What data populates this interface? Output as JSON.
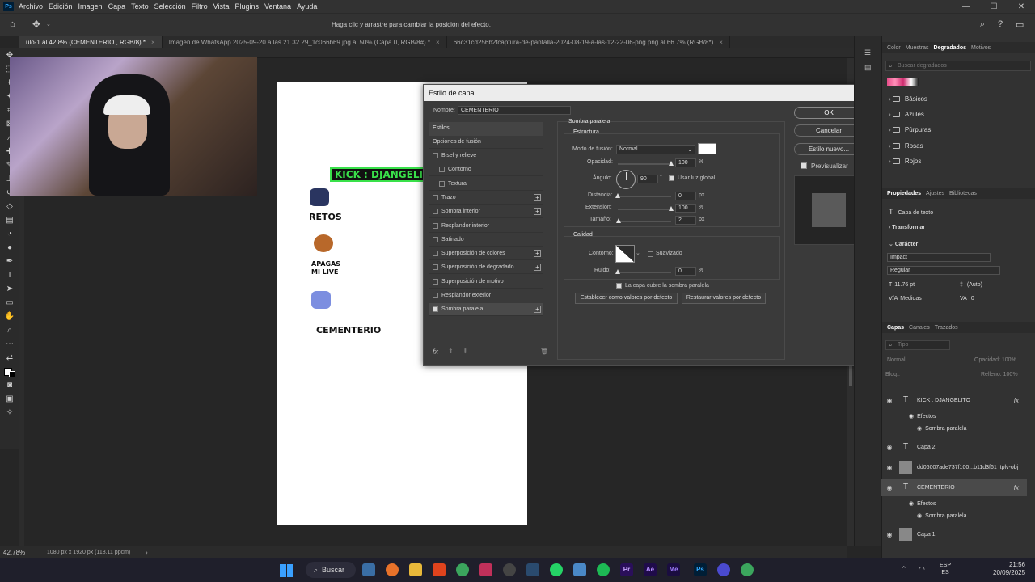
{
  "menu": [
    "Archivo",
    "Edición",
    "Imagen",
    "Capa",
    "Texto",
    "Selección",
    "Filtro",
    "Vista",
    "Plugins",
    "Ventana",
    "Ayuda"
  ],
  "options_hint": "Haga clic y arrastre para cambiar la posición del efecto.",
  "tabs": [
    {
      "label": "ulo-1 al 42.8% (CEMENTERIO , RGB/8) *",
      "active": true
    },
    {
      "label": "Imagen de WhatsApp 2025-09-20 a las 21.32.29_1c066b69.jpg al 50% (Capa 0, RGB/8#) *",
      "active": false
    },
    {
      "label": "66c31cd256b2fcaptura-de-pantalla-2024-08-19-a-las-12-22-06-png.png al 66.7% (RGB/8*)",
      "active": false
    }
  ],
  "status": {
    "zoom": "42.78%",
    "info": "1080 px x 1920 px (118.11 ppcm)"
  },
  "document": {
    "kick_text": "KICK : DJANGELITO",
    "items": [
      "RETOS",
      "APAGAS MI LIVE",
      "CEMENTERIO"
    ]
  },
  "dialog": {
    "title": "Estilo de capa",
    "name_label": "Nombre:",
    "name_value": "CEMENTERIO",
    "styles_header": "Estilos",
    "blend_options": "Opciones de fusión",
    "styles": [
      {
        "label": "Bisel y relieve",
        "checked": false,
        "plus": false
      },
      {
        "label": "Contorno",
        "checked": false,
        "plus": false
      },
      {
        "label": "Textura",
        "checked": false,
        "plus": false
      },
      {
        "label": "Trazo",
        "checked": false,
        "plus": true
      },
      {
        "label": "Sombra interior",
        "checked": false,
        "plus": true
      },
      {
        "label": "Resplandor interior",
        "checked": false,
        "plus": false
      },
      {
        "label": "Satinado",
        "checked": false,
        "plus": false
      },
      {
        "label": "Superposición de colores",
        "checked": false,
        "plus": true
      },
      {
        "label": "Superposición de degradado",
        "checked": false,
        "plus": true
      },
      {
        "label": "Superposición de motivo",
        "checked": false,
        "plus": false
      },
      {
        "label": "Resplandor exterior",
        "checked": false,
        "plus": false
      },
      {
        "label": "Sombra paralela",
        "checked": true,
        "plus": true
      }
    ],
    "section_title": "Sombra paralela",
    "structure_title": "Estructura",
    "blend_mode_label": "Modo de fusión:",
    "blend_mode_value": "Normal",
    "opacity_label": "Opacidad:",
    "opacity_value": "100",
    "opacity_pct": 100,
    "angle_label": "Ángulo:",
    "angle_value": "90",
    "angle_unit": "°",
    "global_light": "Usar luz global",
    "distance_label": "Distancia:",
    "distance_value": "0",
    "distance_pct": 0,
    "spread_label": "Extensión:",
    "spread_value": "100",
    "spread_pct": 100,
    "size_label": "Tamaño:",
    "size_value": "2",
    "size_pct": 1,
    "px": "px",
    "percent": "%",
    "quality_title": "Calidad",
    "contour_label": "Contorno:",
    "antialias": "Suavizado",
    "noise_label": "Ruido:",
    "noise_value": "0",
    "noise_pct": 0,
    "knockout": "La capa cubre la sombra paralela",
    "make_default": "Establecer como valores por defecto",
    "reset_default": "Restaurar valores por defecto",
    "ok": "OK",
    "cancel": "Cancelar",
    "new_style": "Estilo nuevo...",
    "preview": "Previsualizar",
    "shadow_color": "#ffffff"
  },
  "panels": {
    "top_tabs": [
      "Color",
      "Muestras",
      "Degradados",
      "Motivos"
    ],
    "search_placeholder": "Buscar degradados",
    "gradient_folders": [
      "Básicos",
      "Azules",
      "Púrpuras",
      "Rosas",
      "Rojos"
    ],
    "props_tabs": [
      "Propiedades",
      "Ajustes",
      "Bibliotecas"
    ],
    "text_layer": "Capa de texto",
    "transform": "Transformar",
    "character": "Carácter",
    "font": "Impact",
    "font_style": "Regular",
    "font_size": "11.76 pt",
    "leading": "(Auto)",
    "kerning": "Medidas",
    "tracking": "0",
    "layers_tabs": [
      "Capas",
      "Canales",
      "Trazados"
    ],
    "layer_search": "Tipo",
    "blend_mode": "Normal",
    "opacity_label": "Opacidad:",
    "opacity_value": "100%",
    "lock_label": "Bloq.:",
    "fill_label": "Relleno:",
    "fill_value": "100%",
    "layers": [
      {
        "name": "KICK : DJANGELITO",
        "type": "text",
        "fx": true
      },
      {
        "name": "Efectos",
        "type": "effects"
      },
      {
        "name": "Sombra paralela",
        "type": "effect"
      },
      {
        "name": "Capa 2",
        "type": "text",
        "fx": false
      },
      {
        "name": "dd06007ade737f100...b11d3f61_tplv-obj",
        "type": "image",
        "fx": false
      },
      {
        "name": "CEMENTERIO",
        "type": "text",
        "fx": true,
        "selected": true
      },
      {
        "name": "Efectos",
        "type": "effects"
      },
      {
        "name": "Sombra paralela",
        "type": "effect"
      },
      {
        "name": "Capa 1",
        "type": "image",
        "fx": false
      }
    ]
  },
  "taskbar": {
    "search": "Buscar",
    "lang": "ESP",
    "lang2": "ES",
    "time": "21:56",
    "date": "20/09/2025"
  }
}
